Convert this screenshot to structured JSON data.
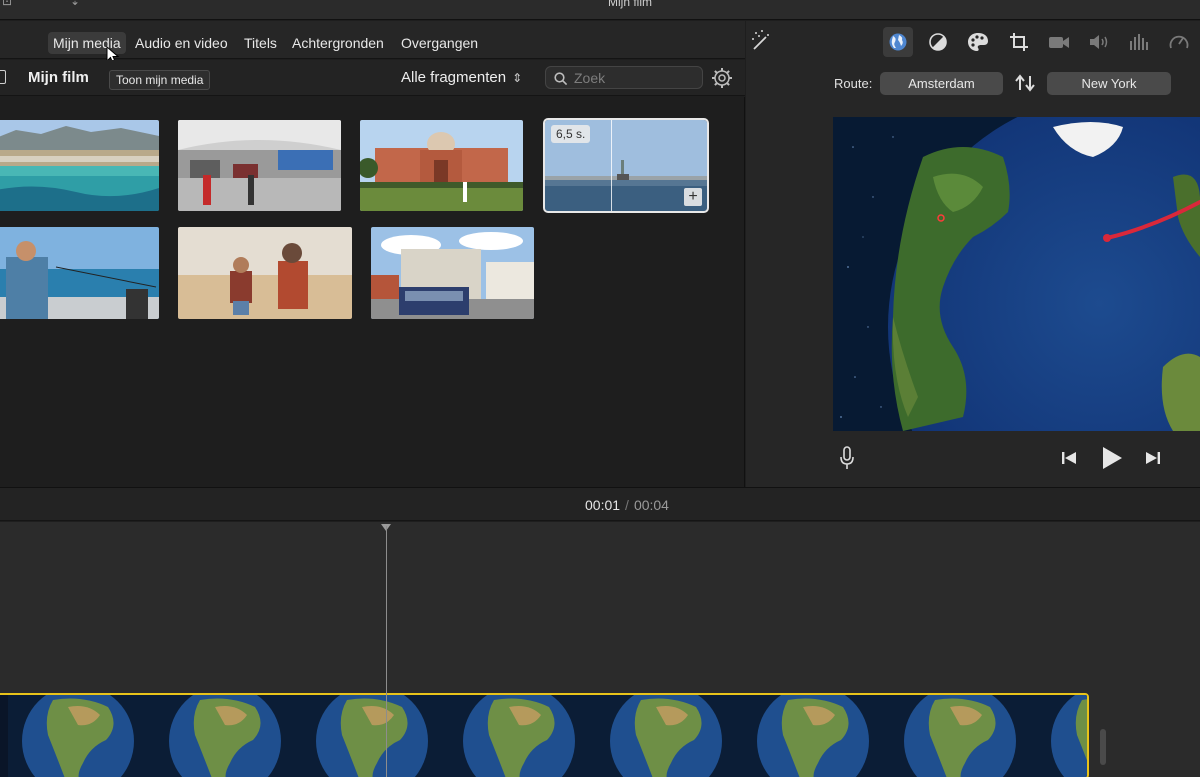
{
  "window": {
    "title": "Mijn film"
  },
  "media_tabs": [
    {
      "id": "mijn-media",
      "label": "Mijn media",
      "active": true
    },
    {
      "id": "audio-en-video",
      "label": "Audio en video",
      "active": false
    },
    {
      "id": "titels",
      "label": "Titels",
      "active": false
    },
    {
      "id": "achtergronden",
      "label": "Achtergronden",
      "active": false
    },
    {
      "id": "overgangen",
      "label": "Overgangen",
      "active": false
    }
  ],
  "browser": {
    "library_title": "Mijn film",
    "tooltip": "Toon mijn media",
    "filter_label": "Alle fragmenten",
    "search_placeholder": "Zoek"
  },
  "media": [
    {
      "name": "clip-beach",
      "selected": false
    },
    {
      "name": "clip-airport",
      "selected": false
    },
    {
      "name": "clip-palace",
      "selected": false
    },
    {
      "name": "clip-liberty",
      "selected": true,
      "duration": "6,5 s."
    },
    {
      "name": "clip-fishing",
      "selected": false
    },
    {
      "name": "clip-desert",
      "selected": false
    },
    {
      "name": "clip-tram",
      "selected": false
    }
  ],
  "viewer_toolbar": [
    {
      "icon": "globe-icon",
      "active": true
    },
    {
      "icon": "color-balance-icon",
      "active": false
    },
    {
      "icon": "palette-icon",
      "active": false
    },
    {
      "icon": "crop-icon",
      "active": false
    },
    {
      "icon": "video-camera-icon",
      "active": false
    },
    {
      "icon": "volume-icon",
      "active": false
    },
    {
      "icon": "equalizer-icon",
      "active": false
    },
    {
      "icon": "speed-icon",
      "active": false
    }
  ],
  "route": {
    "label": "Route:",
    "from": "Amsterdam",
    "to": "New York"
  },
  "timeline": {
    "current": "00:01",
    "separator": "/",
    "total": "00:04"
  },
  "colors": {
    "accent_selection": "#e8c31a",
    "route_line": "#d9283a",
    "active_tool": "#5a8fd6"
  }
}
